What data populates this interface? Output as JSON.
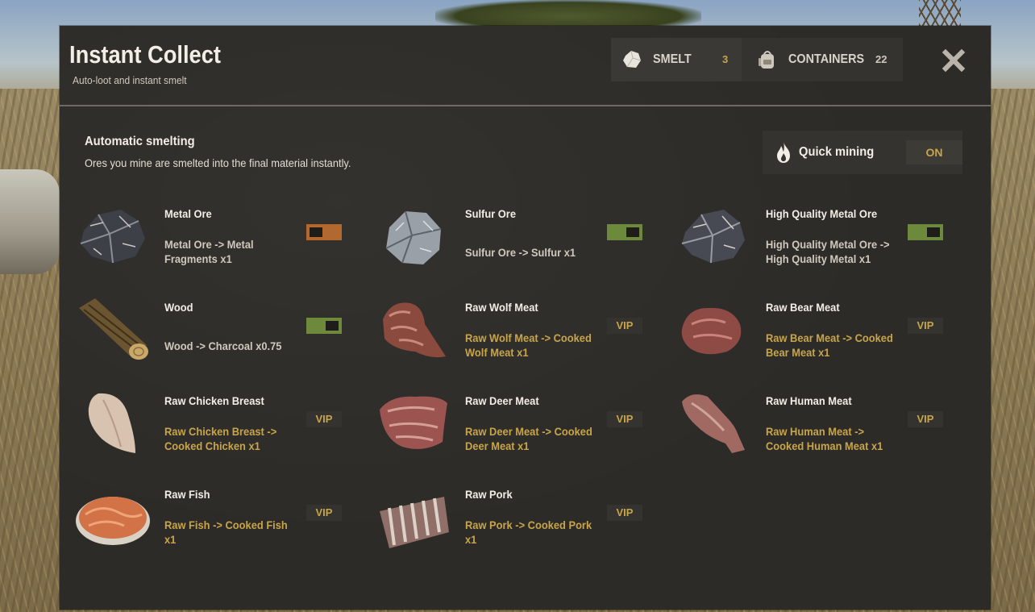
{
  "header": {
    "title": "Instant Collect",
    "subtitle": "Auto-loot and instant smelt"
  },
  "tabs": [
    {
      "label": "SMELT",
      "count": "3",
      "icon": "ore-icon"
    },
    {
      "label": "CONTAINERS",
      "count": "22",
      "icon": "backpack-icon"
    }
  ],
  "section": {
    "title": "Automatic smelting",
    "description": "Ores you mine are smelted into the final material instantly."
  },
  "quick_mining": {
    "label": "Quick mining",
    "state": "ON",
    "icon": "flame-icon"
  },
  "items": [
    {
      "name": "Metal Ore",
      "desc": "Metal Ore -> Metal Fragments x1",
      "control": "toggle",
      "enabled": false,
      "icon": "metal-ore"
    },
    {
      "name": "Sulfur Ore",
      "desc": "Sulfur Ore -> Sulfur x1",
      "control": "toggle",
      "enabled": true,
      "icon": "sulfur-ore"
    },
    {
      "name": "High Quality Metal Ore",
      "desc": "High Quality Metal Ore -> High Quality Metal x1",
      "control": "toggle",
      "enabled": true,
      "icon": "hq-metal-ore"
    },
    {
      "name": "Wood",
      "desc": "Wood -> Charcoal x0.75",
      "control": "toggle",
      "enabled": true,
      "icon": "wood-log"
    },
    {
      "name": "Raw Wolf Meat",
      "desc": "Raw Wolf Meat -> Cooked Wolf Meat x1",
      "control": "vip",
      "badge": "VIP",
      "icon": "wolf-meat"
    },
    {
      "name": "Raw Bear Meat",
      "desc": "Raw Bear Meat -> Cooked Bear Meat x1",
      "control": "vip",
      "badge": "VIP",
      "icon": "bear-meat"
    },
    {
      "name": "Raw Chicken Breast",
      "desc": "Raw Chicken Breast -> Cooked Chicken x1",
      "control": "vip",
      "badge": "VIP",
      "icon": "chicken-breast"
    },
    {
      "name": "Raw Deer Meat",
      "desc": "Raw Deer Meat -> Cooked Deer Meat x1",
      "control": "vip",
      "badge": "VIP",
      "icon": "deer-meat"
    },
    {
      "name": "Raw Human Meat",
      "desc": "Raw Human Meat -> Cooked Human Meat x1",
      "control": "vip",
      "badge": "VIP",
      "icon": "human-meat"
    },
    {
      "name": "Raw Fish",
      "desc": "Raw Fish -> Cooked Fish x1",
      "control": "vip",
      "badge": "VIP",
      "icon": "fish-steak"
    },
    {
      "name": "Raw Pork",
      "desc": "Raw Pork -> Cooked Pork x1",
      "control": "vip",
      "badge": "VIP",
      "icon": "pork-ribs"
    }
  ],
  "colors": {
    "panel": "#2d2b27",
    "accent_gold": "#c8a54b",
    "toggle_on": "#6d8a3c",
    "toggle_off": "#b2692f"
  }
}
